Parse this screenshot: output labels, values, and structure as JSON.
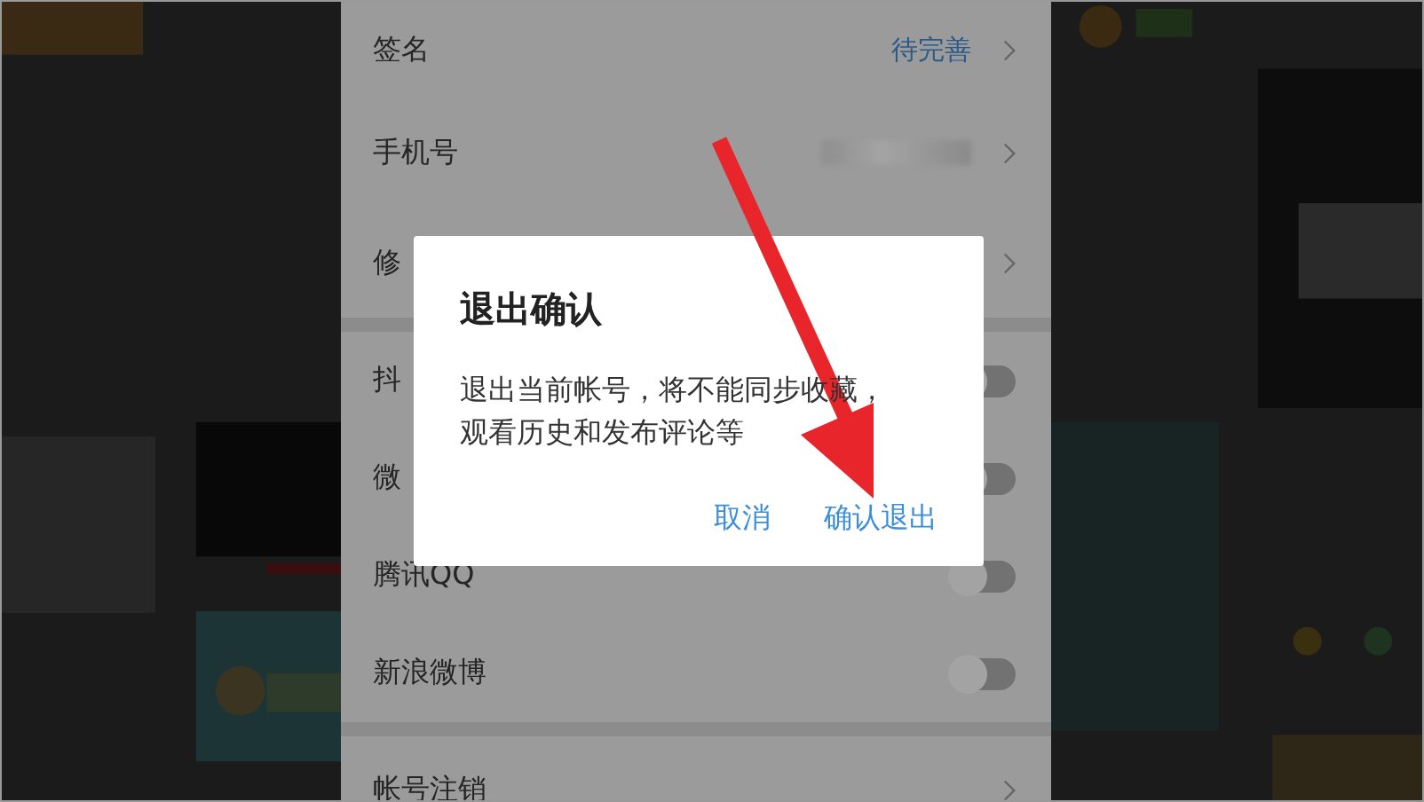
{
  "sections": [
    {
      "rows": [
        {
          "kind": "link",
          "label": "签名",
          "value": "待完善"
        },
        {
          "kind": "masked",
          "label": "手机号"
        },
        {
          "kind": "link",
          "label": "修"
        }
      ]
    },
    {
      "rows": [
        {
          "kind": "toggle",
          "label": "抖",
          "on": false
        },
        {
          "kind": "toggle",
          "label": "微",
          "on": false
        },
        {
          "kind": "toggle",
          "label": "腾讯QQ",
          "on": false
        },
        {
          "kind": "toggle",
          "label": "新浪微博",
          "on": false
        }
      ]
    },
    {
      "rows": [
        {
          "kind": "link",
          "label": "帐号注销"
        }
      ]
    }
  ],
  "dialog": {
    "title": "退出确认",
    "message": "退出当前帐号，将不能同步收藏，观看历史和发布评论等",
    "buttons": [
      {
        "label": "取消"
      },
      {
        "label": "确认退出"
      }
    ]
  }
}
